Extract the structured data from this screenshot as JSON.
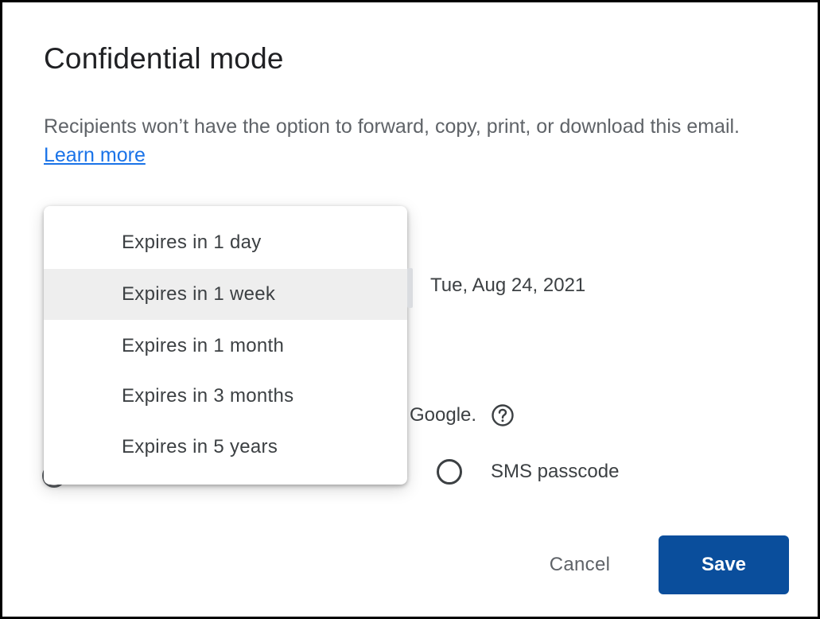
{
  "dialog": {
    "title": "Confidential mode",
    "description_prefix": "Recipients won’t have the option to forward, copy, print, or download this email. ",
    "learn_more_label": "Learn more"
  },
  "expiry": {
    "date_value": "Tue, Aug 24, 2021",
    "options": [
      {
        "label": "Expires in 1 day"
      },
      {
        "label": "Expires in 1 week"
      },
      {
        "label": "Expires in 1 month"
      },
      {
        "label": "Expires in 3 months"
      },
      {
        "label": "Expires in 5 years"
      }
    ],
    "selected_label": "Expires in 1 week"
  },
  "passcode": {
    "partial_text": "Google.",
    "help_icon": "help-circle-icon",
    "sms_label": "SMS passcode"
  },
  "actions": {
    "cancel_label": "Cancel",
    "save_label": "Save"
  },
  "colors": {
    "save_button": "#0a4e9c",
    "link": "#1a73e8",
    "selected_item_bg": "#eeeeee"
  }
}
